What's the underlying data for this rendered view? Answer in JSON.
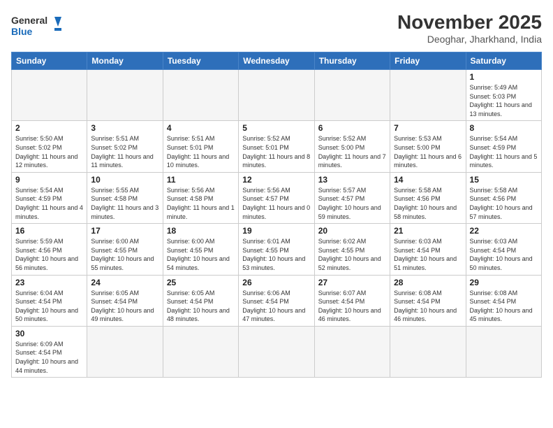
{
  "logo": {
    "general": "General",
    "blue": "Blue"
  },
  "title": {
    "month_year": "November 2025",
    "location": "Deoghar, Jharkhand, India"
  },
  "weekdays": [
    "Sunday",
    "Monday",
    "Tuesday",
    "Wednesday",
    "Thursday",
    "Friday",
    "Saturday"
  ],
  "weeks": [
    [
      {
        "day": "",
        "info": ""
      },
      {
        "day": "",
        "info": ""
      },
      {
        "day": "",
        "info": ""
      },
      {
        "day": "",
        "info": ""
      },
      {
        "day": "",
        "info": ""
      },
      {
        "day": "",
        "info": ""
      },
      {
        "day": "1",
        "info": "Sunrise: 5:49 AM\nSunset: 5:03 PM\nDaylight: 11 hours and 13 minutes."
      }
    ],
    [
      {
        "day": "2",
        "info": "Sunrise: 5:50 AM\nSunset: 5:02 PM\nDaylight: 11 hours and 12 minutes."
      },
      {
        "day": "3",
        "info": "Sunrise: 5:51 AM\nSunset: 5:02 PM\nDaylight: 11 hours and 11 minutes."
      },
      {
        "day": "4",
        "info": "Sunrise: 5:51 AM\nSunset: 5:01 PM\nDaylight: 11 hours and 10 minutes."
      },
      {
        "day": "5",
        "info": "Sunrise: 5:52 AM\nSunset: 5:01 PM\nDaylight: 11 hours and 8 minutes."
      },
      {
        "day": "6",
        "info": "Sunrise: 5:52 AM\nSunset: 5:00 PM\nDaylight: 11 hours and 7 minutes."
      },
      {
        "day": "7",
        "info": "Sunrise: 5:53 AM\nSunset: 5:00 PM\nDaylight: 11 hours and 6 minutes."
      },
      {
        "day": "8",
        "info": "Sunrise: 5:54 AM\nSunset: 4:59 PM\nDaylight: 11 hours and 5 minutes."
      }
    ],
    [
      {
        "day": "9",
        "info": "Sunrise: 5:54 AM\nSunset: 4:59 PM\nDaylight: 11 hours and 4 minutes."
      },
      {
        "day": "10",
        "info": "Sunrise: 5:55 AM\nSunset: 4:58 PM\nDaylight: 11 hours and 3 minutes."
      },
      {
        "day": "11",
        "info": "Sunrise: 5:56 AM\nSunset: 4:58 PM\nDaylight: 11 hours and 1 minute."
      },
      {
        "day": "12",
        "info": "Sunrise: 5:56 AM\nSunset: 4:57 PM\nDaylight: 11 hours and 0 minutes."
      },
      {
        "day": "13",
        "info": "Sunrise: 5:57 AM\nSunset: 4:57 PM\nDaylight: 10 hours and 59 minutes."
      },
      {
        "day": "14",
        "info": "Sunrise: 5:58 AM\nSunset: 4:56 PM\nDaylight: 10 hours and 58 minutes."
      },
      {
        "day": "15",
        "info": "Sunrise: 5:58 AM\nSunset: 4:56 PM\nDaylight: 10 hours and 57 minutes."
      }
    ],
    [
      {
        "day": "16",
        "info": "Sunrise: 5:59 AM\nSunset: 4:56 PM\nDaylight: 10 hours and 56 minutes."
      },
      {
        "day": "17",
        "info": "Sunrise: 6:00 AM\nSunset: 4:55 PM\nDaylight: 10 hours and 55 minutes."
      },
      {
        "day": "18",
        "info": "Sunrise: 6:00 AM\nSunset: 4:55 PM\nDaylight: 10 hours and 54 minutes."
      },
      {
        "day": "19",
        "info": "Sunrise: 6:01 AM\nSunset: 4:55 PM\nDaylight: 10 hours and 53 minutes."
      },
      {
        "day": "20",
        "info": "Sunrise: 6:02 AM\nSunset: 4:55 PM\nDaylight: 10 hours and 52 minutes."
      },
      {
        "day": "21",
        "info": "Sunrise: 6:03 AM\nSunset: 4:54 PM\nDaylight: 10 hours and 51 minutes."
      },
      {
        "day": "22",
        "info": "Sunrise: 6:03 AM\nSunset: 4:54 PM\nDaylight: 10 hours and 50 minutes."
      }
    ],
    [
      {
        "day": "23",
        "info": "Sunrise: 6:04 AM\nSunset: 4:54 PM\nDaylight: 10 hours and 50 minutes."
      },
      {
        "day": "24",
        "info": "Sunrise: 6:05 AM\nSunset: 4:54 PM\nDaylight: 10 hours and 49 minutes."
      },
      {
        "day": "25",
        "info": "Sunrise: 6:05 AM\nSunset: 4:54 PM\nDaylight: 10 hours and 48 minutes."
      },
      {
        "day": "26",
        "info": "Sunrise: 6:06 AM\nSunset: 4:54 PM\nDaylight: 10 hours and 47 minutes."
      },
      {
        "day": "27",
        "info": "Sunrise: 6:07 AM\nSunset: 4:54 PM\nDaylight: 10 hours and 46 minutes."
      },
      {
        "day": "28",
        "info": "Sunrise: 6:08 AM\nSunset: 4:54 PM\nDaylight: 10 hours and 46 minutes."
      },
      {
        "day": "29",
        "info": "Sunrise: 6:08 AM\nSunset: 4:54 PM\nDaylight: 10 hours and 45 minutes."
      }
    ],
    [
      {
        "day": "30",
        "info": "Sunrise: 6:09 AM\nSunset: 4:54 PM\nDaylight: 10 hours and 44 minutes."
      },
      {
        "day": "",
        "info": ""
      },
      {
        "day": "",
        "info": ""
      },
      {
        "day": "",
        "info": ""
      },
      {
        "day": "",
        "info": ""
      },
      {
        "day": "",
        "info": ""
      },
      {
        "day": "",
        "info": ""
      }
    ]
  ]
}
